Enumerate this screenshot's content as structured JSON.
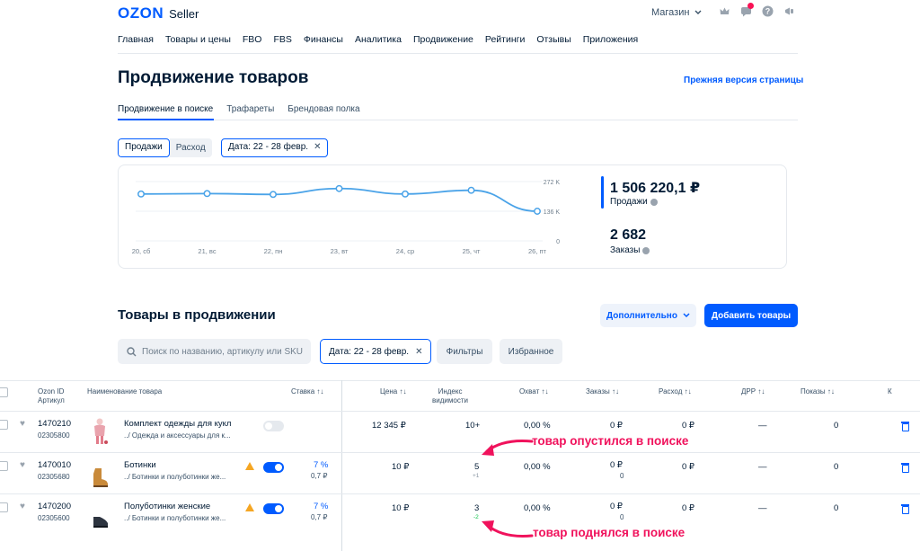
{
  "header": {
    "logo_main": "OZON",
    "logo_sub": "Seller",
    "store_label": "Магазин",
    "nav": [
      "Главная",
      "Товары и цены",
      "FBO",
      "FBS",
      "Финансы",
      "Аналитика",
      "Продвижение",
      "Рейтинги",
      "Отзывы",
      "Приложения"
    ]
  },
  "page": {
    "title": "Продвижение товаров",
    "old_version_link": "Прежняя версия страницы",
    "tabs": [
      "Продвижение в поиске",
      "Трафареты",
      "Брендовая полка"
    ]
  },
  "chart_controls": {
    "segments": [
      "Продажи",
      "Расход"
    ],
    "date_chip": "Дата: 22 - 28 февр."
  },
  "chart_data": {
    "type": "line",
    "x": [
      "20, сб",
      "21, вс",
      "22, пн",
      "23, вт",
      "24, ср",
      "25, чт",
      "26, пт"
    ],
    "y_ticks": [
      "272 K",
      "136 K",
      "0"
    ],
    "ylim": [
      0,
      272
    ],
    "series": [
      {
        "values": [
          215,
          217,
          213,
          240,
          215,
          232,
          136
        ]
      }
    ],
    "color": "#4aa3e8"
  },
  "metrics": {
    "sales_value": "1 506 220,1 ₽",
    "sales_label": "Продажи",
    "orders_value": "2 682",
    "orders_label": "Заказы"
  },
  "products_section": {
    "title": "Товары в продвижении",
    "more_button": "Дополнительно",
    "add_button": "Добавить товары",
    "search_placeholder": "Поиск по названию, артикулу или SKU",
    "date_chip": "Дата: 22 - 28 февр.",
    "filters_button": "Фильтры",
    "favorites_button": "Избранное"
  },
  "table": {
    "headers": {
      "ozon_id": "Ozon ID",
      "article": "Артикул",
      "name": "Наименование товара",
      "bid": "Ставка ↑↓",
      "price": "Цена ↑↓",
      "index1": "Индекс",
      "index2": "видимости",
      "reach": "Охват ↑↓",
      "orders": "Заказы ↑↓",
      "expense": "Расход ↑↓",
      "drr": "ДРР ↑↓",
      "views": "Показы ↑↓",
      "extra": "К"
    },
    "rows": [
      {
        "id": "1470210",
        "article": "02305800",
        "name": "Комплект одежды для кукл",
        "category": "../ Одежда и аксессуары для к...",
        "bid": "",
        "bid_sub": "",
        "price": "12 345 ₽",
        "index": "10+",
        "index_change": "",
        "reach": "0,00 %",
        "orders": "0 ₽",
        "orders_sub": "",
        "expense": "0 ₽",
        "drr": "—",
        "views": "0"
      },
      {
        "id": "1470010",
        "article": "02305680",
        "name": "Ботинки",
        "category": "../ Ботинки и полуботинки же...",
        "bid": "7 %",
        "bid_sub": "0,7 ₽",
        "price": "10 ₽",
        "index": "5",
        "index_change": "+1",
        "reach": "0,00 %",
        "orders": "0 ₽",
        "orders_sub": "0",
        "expense": "0 ₽",
        "drr": "—",
        "views": "0"
      },
      {
        "id": "1470200",
        "article": "02305600",
        "name": "Полуботинки женские",
        "category": "../ Ботинки и полуботинки же...",
        "bid": "7 %",
        "bid_sub": "0,7 ₽",
        "price": "10 ₽",
        "index": "3",
        "index_change": "-2",
        "reach": "0,00 %",
        "orders": "0 ₽",
        "orders_sub": "0",
        "expense": "0 ₽",
        "drr": "—",
        "views": "0"
      }
    ]
  },
  "annotations": {
    "down": "товар опустился в поиске",
    "up": "товар поднялся в поиске"
  }
}
